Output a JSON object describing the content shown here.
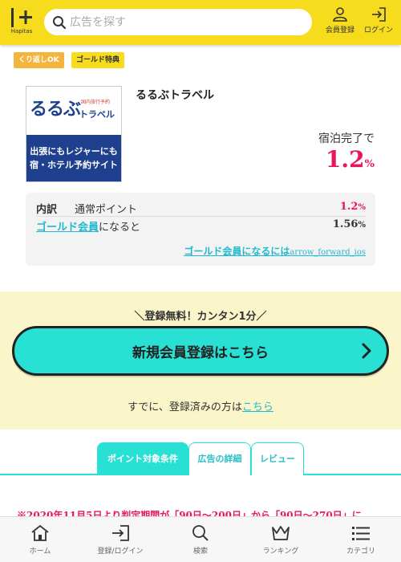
{
  "header": {
    "logo_text": "Hapitas",
    "search_placeholder": "広告を探す",
    "register_label": "会員登録",
    "login_label": "ログイン"
  },
  "badges": {
    "repeat": "くり返しOK",
    "gold": "ゴールド特典"
  },
  "advertiser": {
    "title": "るるぶトラベル",
    "image_brand": "るるぶ",
    "image_small": "国内旅行予約",
    "image_sub": "トラベル",
    "image_line1": "出張にもレジャーにも",
    "image_line2": "宿・ホテル予約サイト",
    "condition": "宿泊完了で",
    "rate": "1.2",
    "rate_unit": "%"
  },
  "breakdown": {
    "heading": "内訳",
    "normal_label": "通常ポイント",
    "normal_value": "1.2",
    "gold_link": "ゴールド会員",
    "gold_suffix": "になると",
    "gold_value": "1.56",
    "unit": "%",
    "gold_howto": "ゴールド会員になるには",
    "gold_howto_icon": "arrow_forward_ios"
  },
  "register": {
    "catch": "＼登録無料！カンタン1分／",
    "button_label": "新規会員登録はこちら",
    "already_prefix": "すでに、登録済みの方は",
    "already_link": "こちら"
  },
  "tabs": [
    {
      "label": "ポイント対象条件",
      "active": true
    },
    {
      "label": "広告の詳細",
      "active": false
    },
    {
      "label": "レビュー",
      "active": false
    }
  ],
  "notice": "※2020年11月5日より判定期間が「90日～200日」から「90日～270日」に",
  "bottom_nav": [
    {
      "label": "ホーム",
      "icon": "home-icon"
    },
    {
      "label": "登録/ログイン",
      "icon": "login-icon"
    },
    {
      "label": "検索",
      "icon": "search-icon"
    },
    {
      "label": "ランキング",
      "icon": "crown-icon"
    },
    {
      "label": "カテゴリ",
      "icon": "list-icon"
    }
  ],
  "colors": {
    "header_bg": "#f7dc1e",
    "accent": "#28e0d3",
    "link": "#1fb9d0",
    "pink": "#e8175d",
    "register_bg": "#fbf6c9"
  }
}
